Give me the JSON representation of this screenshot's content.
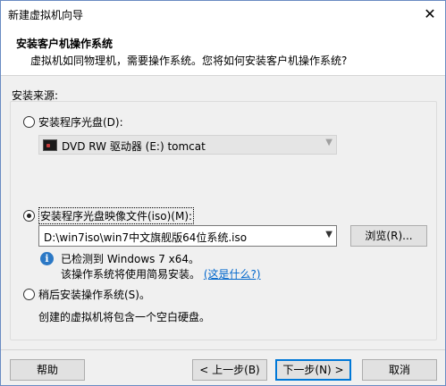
{
  "window": {
    "title": "新建虚拟机向导",
    "close_glyph": "✕"
  },
  "header": {
    "title": "安装客户机操作系统",
    "subtitle": "虚拟机如同物理机，需要操作系统。您将如何安装客户机操作系统?"
  },
  "source": {
    "label": "安装来源:",
    "options": [
      {
        "label": "安装程序光盘(D):",
        "selected": false
      },
      {
        "label": "安装程序光盘映像文件(iso)(M):",
        "selected": true
      },
      {
        "label": "稍后安装操作系统(S)。",
        "selected": false
      }
    ],
    "disc_drive": {
      "value": "DVD RW 驱动器 (E:) tomcat",
      "icon": "dvd-drive-icon",
      "enabled": false
    },
    "iso_path": {
      "value": "D:\\win7iso\\win7中文旗舰版64位系统.iso"
    },
    "browse_label": "浏览(R)...",
    "detect_line1": "已检测到 Windows 7 x64。",
    "detect_line2": "该操作系统将使用简易安装。",
    "detect_link": "(这是什么?)",
    "later_description": "创建的虚拟机将包含一个空白硬盘。"
  },
  "footer": {
    "help": "帮助",
    "back": "< 上一步(B)",
    "next": "下一步(N) >",
    "cancel": "取消"
  },
  "colors": {
    "accent": "#0078d7",
    "link": "#0066cc",
    "info": "#2b78c5"
  }
}
